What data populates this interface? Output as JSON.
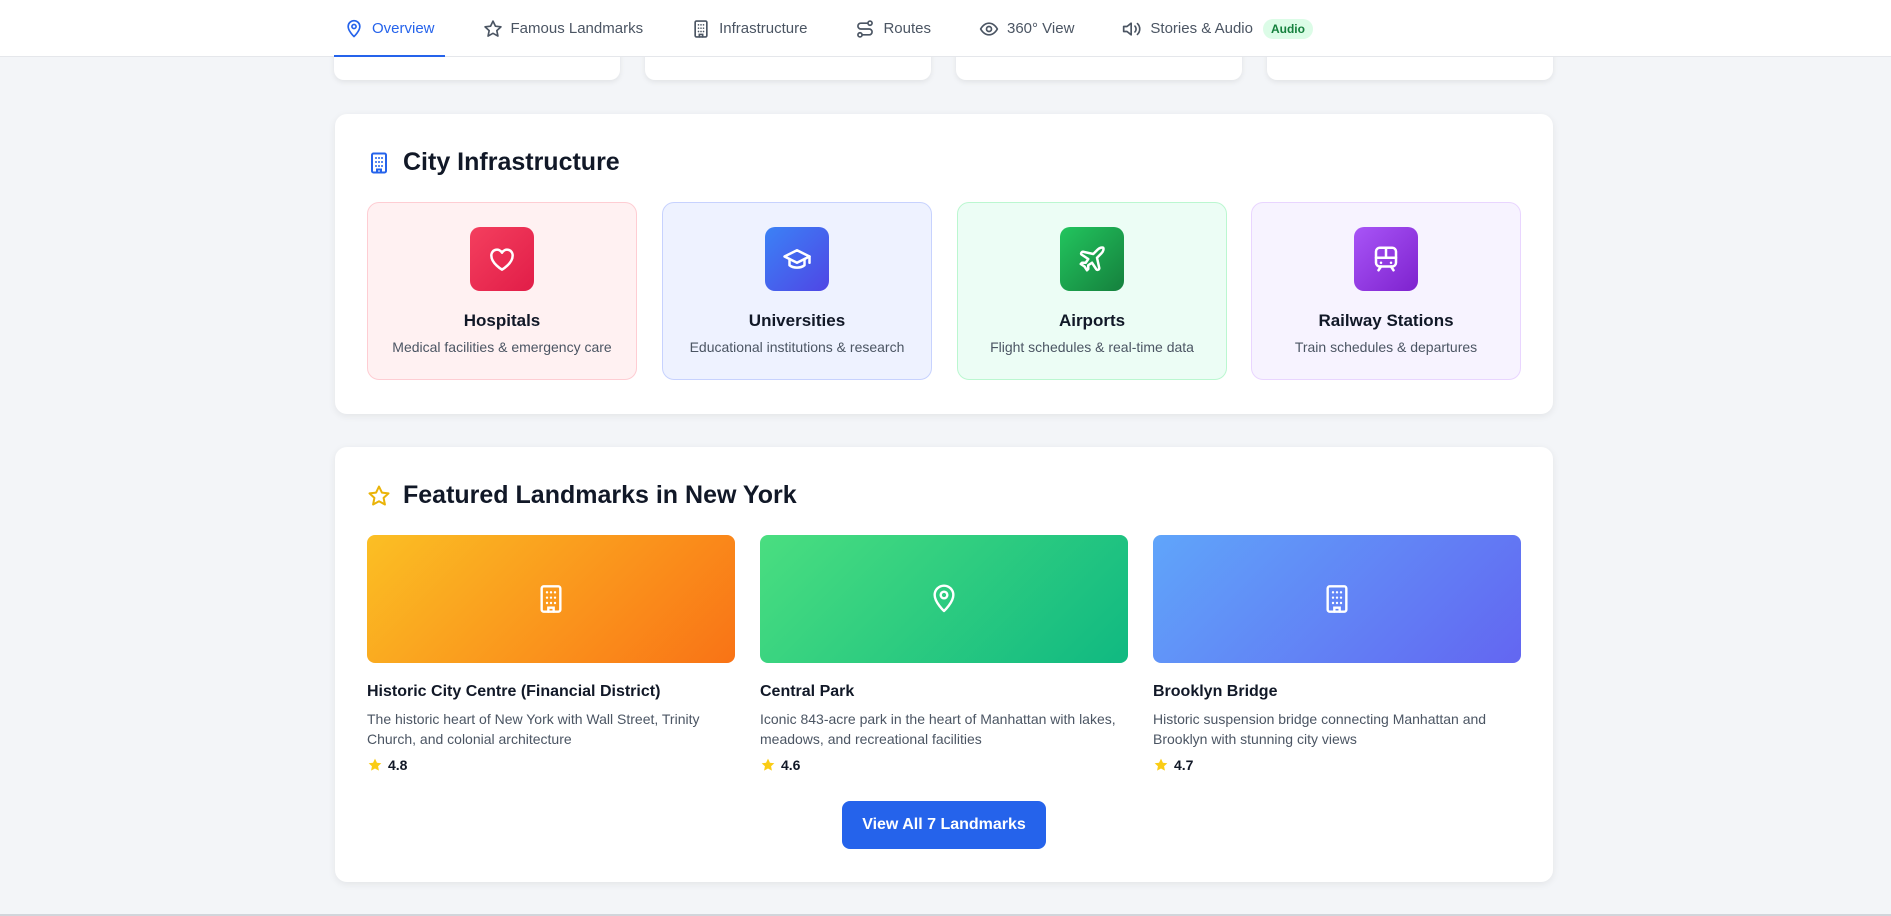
{
  "nav": {
    "tabs": [
      {
        "label": "Overview",
        "icon": "map-pin-icon",
        "active": true
      },
      {
        "label": "Famous Landmarks",
        "icon": "star-icon"
      },
      {
        "label": "Infrastructure",
        "icon": "building-icon"
      },
      {
        "label": "Routes",
        "icon": "route-icon"
      },
      {
        "label": "360° View",
        "icon": "eye-icon"
      },
      {
        "label": "Stories & Audio",
        "icon": "speaker-icon",
        "badge": "Audio"
      }
    ]
  },
  "infrastructure": {
    "title": "City Infrastructure",
    "title_icon": "building-icon",
    "items": [
      {
        "name": "Hospitals",
        "desc": "Medical facilities & emergency care",
        "icon": "heart-icon",
        "color": "#e11d48",
        "bg": "#fff1f2"
      },
      {
        "name": "Universities",
        "desc": "Educational institutions & research",
        "icon": "graduation-cap-icon",
        "color": "#4f46e5",
        "bg": "#eef2ff"
      },
      {
        "name": "Airports",
        "desc": "Flight schedules & real-time data",
        "icon": "plane-icon",
        "color": "#16a34a",
        "bg": "#ecfdf5"
      },
      {
        "name": "Railway Stations",
        "desc": "Train schedules & departures",
        "icon": "train-icon",
        "color": "#9333ea",
        "bg": "#f7f3ff"
      }
    ]
  },
  "landmarks": {
    "title": "Featured Landmarks in New York",
    "title_icon": "star-icon",
    "items": [
      {
        "name": "Historic City Centre (Financial District)",
        "desc": "The historic heart of New York with Wall Street, Trinity Church, and colonial architecture",
        "rating": "4.8",
        "icon": "building-icon",
        "gradient": [
          "#fbbf24",
          "#f97316"
        ]
      },
      {
        "name": "Central Park",
        "desc": "Iconic 843-acre park in the heart of Manhattan with lakes, meadows, and recreational facilities",
        "rating": "4.6",
        "icon": "map-pin-icon",
        "gradient": [
          "#4ade80",
          "#10b981"
        ]
      },
      {
        "name": "Brooklyn Bridge",
        "desc": "Historic suspension bridge connecting Manhattan and Brooklyn with stunning city views",
        "rating": "4.7",
        "icon": "building-icon",
        "gradient": [
          "#60a5fa",
          "#6366f1"
        ]
      }
    ],
    "view_all_label": "View All 7 Landmarks"
  },
  "colors": {
    "accent": "#2563eb",
    "star": "#facc15"
  }
}
